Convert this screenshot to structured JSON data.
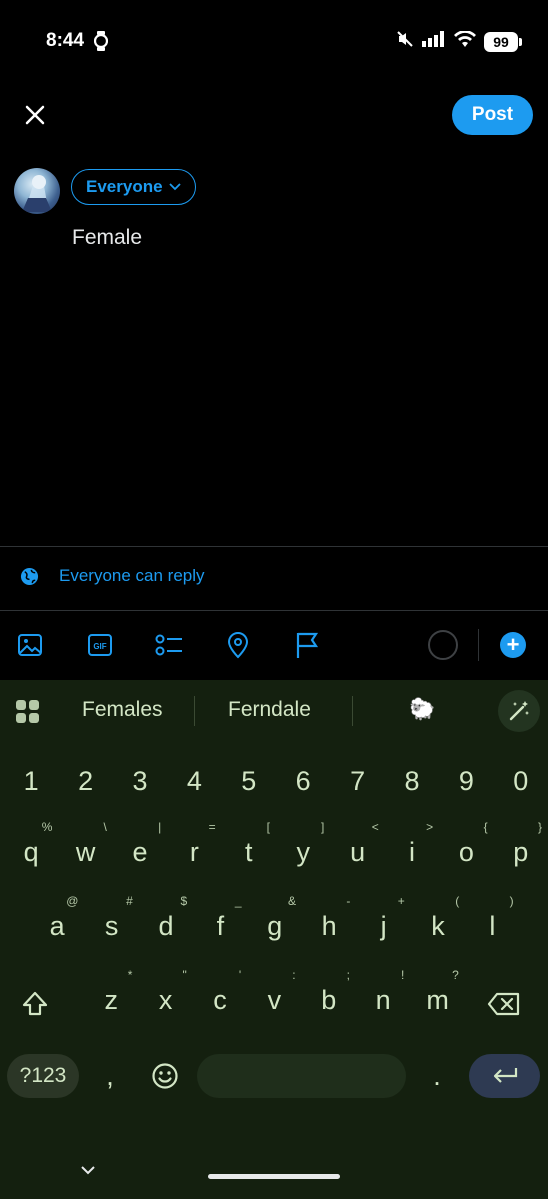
{
  "status_bar": {
    "time": "8:44",
    "battery": "99",
    "icons": [
      "watch-icon",
      "mute-icon",
      "signal-icon",
      "wifi-icon",
      "battery-icon"
    ]
  },
  "compose": {
    "post_label": "Post",
    "audience_label": "Everyone",
    "text": "Female",
    "reply_setting": "Everyone can reply",
    "accent_color": "#1d9bf0",
    "toolbar_icons": [
      "image-icon",
      "gif-icon",
      "poll-icon",
      "location-icon",
      "flag-icon",
      "progress-ring-icon",
      "add-icon"
    ],
    "gif_label": "GIF",
    "add_label": "+"
  },
  "keyboard": {
    "suggestions": [
      "Females",
      "Ferndale",
      "🐑"
    ],
    "number_row": [
      "1",
      "2",
      "3",
      "4",
      "5",
      "6",
      "7",
      "8",
      "9",
      "0"
    ],
    "row1": [
      {
        "key": "q",
        "hint": "%"
      },
      {
        "key": "w",
        "hint": "\\"
      },
      {
        "key": "e",
        "hint": "|"
      },
      {
        "key": "r",
        "hint": "="
      },
      {
        "key": "t",
        "hint": "["
      },
      {
        "key": "y",
        "hint": "]"
      },
      {
        "key": "u",
        "hint": "<"
      },
      {
        "key": "i",
        "hint": ">"
      },
      {
        "key": "o",
        "hint": "{"
      },
      {
        "key": "p",
        "hint": "}"
      }
    ],
    "row2": [
      {
        "key": "a",
        "hint": "@"
      },
      {
        "key": "s",
        "hint": "#"
      },
      {
        "key": "d",
        "hint": "$"
      },
      {
        "key": "f",
        "hint": "_"
      },
      {
        "key": "g",
        "hint": "&"
      },
      {
        "key": "h",
        "hint": "-"
      },
      {
        "key": "j",
        "hint": "+"
      },
      {
        "key": "k",
        "hint": "("
      },
      {
        "key": "l",
        "hint": ")"
      }
    ],
    "row3": [
      {
        "key": "z",
        "hint": "*"
      },
      {
        "key": "x",
        "hint": "\""
      },
      {
        "key": "c",
        "hint": "'"
      },
      {
        "key": "v",
        "hint": ":"
      },
      {
        "key": "b",
        "hint": ";"
      },
      {
        "key": "n",
        "hint": "!"
      },
      {
        "key": "m",
        "hint": "?"
      }
    ],
    "symbols_label": "?123",
    "comma": ",",
    "period": ".",
    "theme_color": "#14200f"
  }
}
